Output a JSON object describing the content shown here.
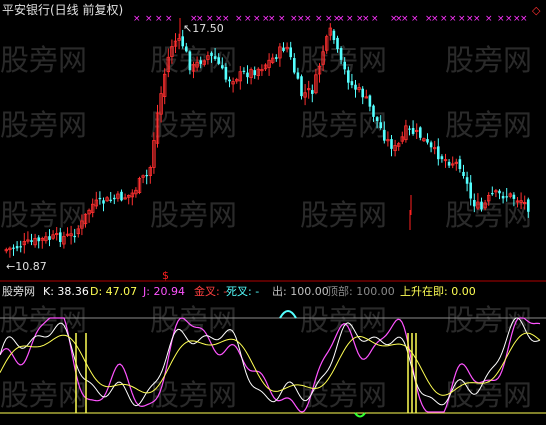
{
  "top_panel": {
    "title": "平安银行(日线 前复权)",
    "high_label": "17.50",
    "low_label": "10.87",
    "buy_marker": "$",
    "corner_glyph": "◇",
    "colors": {
      "up": "#ff3030",
      "down": "#54ffff",
      "marker": "#ff33ff",
      "signal": "#ff2020"
    }
  },
  "indicator_panel": {
    "name": "股旁网",
    "values": [
      {
        "label": "K:",
        "value": "38.36",
        "color": "#ffffff"
      },
      {
        "label": "D:",
        "value": "47.07",
        "color": "#ffff54"
      },
      {
        "label": "J:",
        "value": "20.94",
        "color": "#ff54ff"
      },
      {
        "label": "金叉:",
        "value": "-",
        "color": "#ff4040"
      },
      {
        "label": "死叉:",
        "value": "-",
        "color": "#54ffff"
      },
      {
        "label": "出:",
        "value": "100.00",
        "color": "#c0c0c0"
      },
      {
        "label": "顶部:",
        "value": "100.00",
        "color": "#8a8a8a"
      },
      {
        "label": "上升在即:",
        "value": "0.00",
        "color": "#ffff54"
      }
    ]
  },
  "watermark": "股旁网"
}
